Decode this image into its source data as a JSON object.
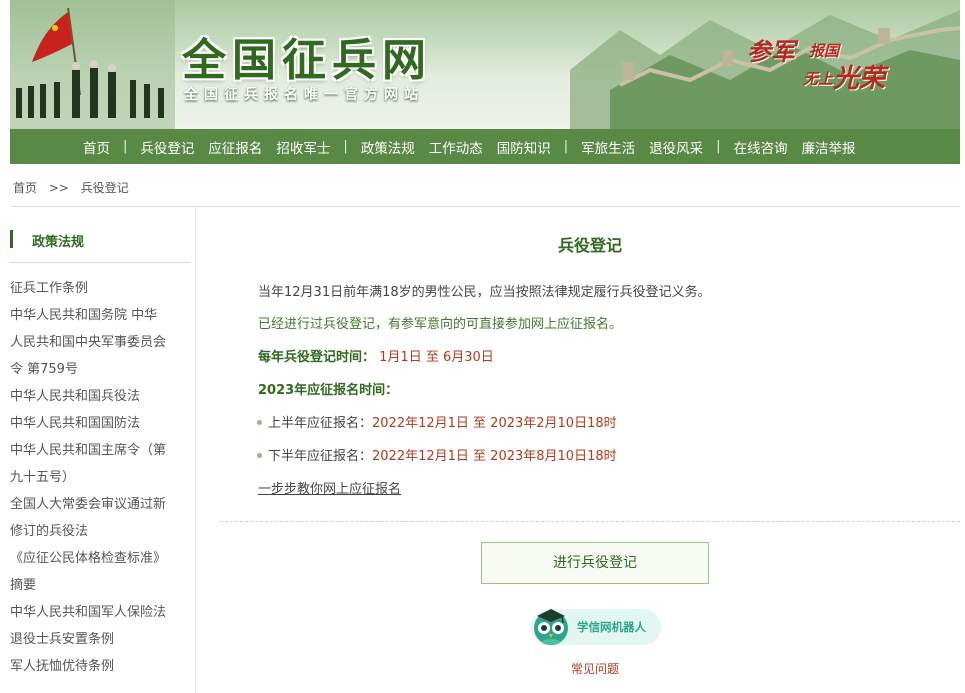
{
  "header": {
    "title": "全国征兵网",
    "subtitle": "全国征兵报名唯一官方网站",
    "slogan": [
      "参军",
      "报国",
      "无上",
      "光荣"
    ]
  },
  "nav": {
    "items": [
      "首页",
      "兵役登记",
      "应征报名",
      "招收军士",
      "政策法规",
      "工作动态",
      "国防知识",
      "军旅生活",
      "退役风采",
      "在线咨询",
      "廉洁举报"
    ],
    "separator": "|"
  },
  "breadcrumb": {
    "home": "首页",
    "sep": ">>",
    "current": "兵役登记"
  },
  "sidebar": {
    "heading": "政策法规",
    "items": [
      "征兵工作条例",
      "中华人民共和国务院 中华",
      "人民共和国中央军事委员会",
      "令 第759号",
      "中华人民共和国兵役法",
      "中华人民共和国国防法",
      "中华人民共和国主席令（第",
      "九十五号）",
      "全国人大常委会审议通过新",
      "修订的兵役法",
      "《应征公民体格检查标准》",
      "摘要",
      "中华人民共和国军人保险法",
      "退役士兵安置条例",
      "军人抚恤优待条例"
    ]
  },
  "main": {
    "title": "兵役登记",
    "para1": "当年12月31日前年满18岁的男性公民，应当按照法律规定履行兵役登记义务。",
    "para2": "已经进行过兵役登记，有参军意向的可直接参加网上应征报名。",
    "reg_time_label": "每年兵役登记时间：",
    "reg_time_value": "1月1日 至 6月30日",
    "enlist_label": "2023年应征报名时间：",
    "first_half_label": "上半年应征报名：",
    "first_half_value": "2022年12月1日 至 2023年2月10日18时",
    "second_half_label": "下半年应征报名：",
    "second_half_value": "2022年12月1日 至 2023年8月10日18时",
    "guide_link": "一步步教你网上应征报名",
    "register_button": "进行兵役登记",
    "robot_label": "学信网机器人",
    "faq_link": "常见问题"
  },
  "colors": {
    "nav_bg": "#588a45",
    "title_green": "#2f6a1f",
    "date_red": "#b23a1a",
    "robot_teal": "#2ea58a"
  },
  "icons": [
    "flag-icon",
    "robot-owl-icon",
    "bullet-dot-icon"
  ]
}
